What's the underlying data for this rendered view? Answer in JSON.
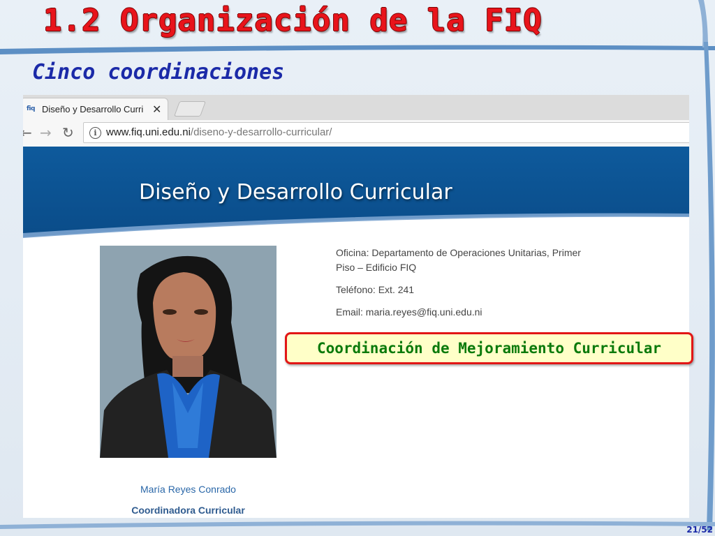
{
  "slide": {
    "title": "1.2 Organización de la FIQ",
    "subtitle": "Cinco coordinaciones",
    "page_number": "21/52",
    "colors": {
      "title": "#e8141b",
      "subtitle": "#1b2aa8",
      "callout_border": "#e21616",
      "callout_text": "#0b7a0b"
    }
  },
  "browser": {
    "tab": {
      "favicon": "fiq-favicon",
      "title": "Diseño y Desarrollo Curri"
    },
    "nav": {
      "back": "back-arrow-icon",
      "forward": "forward-arrow-icon",
      "reload": "reload-icon"
    },
    "address": {
      "host": "www.fiq.uni.edu.ni",
      "path": "/diseno-y-desarrollo-curricular/"
    }
  },
  "page": {
    "heading": "Diseño y Desarrollo Curricular",
    "office": "Oficina: Departamento de Operaciones Unitarias, Primer Piso – Edificio FIQ",
    "phone": "Teléfono: Ext. 241",
    "email": "Email: maria.reyes@fiq.uni.edu.ni",
    "person_name": "María Reyes Conrado",
    "person_role": "Coordinadora Curricular"
  },
  "callout": {
    "text": "Coordinación de Mejoramiento Curricular"
  }
}
